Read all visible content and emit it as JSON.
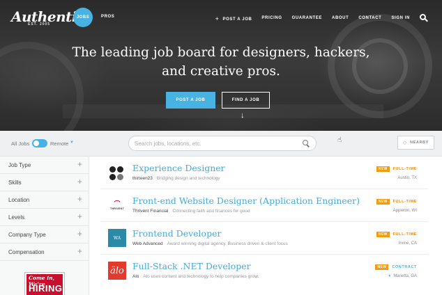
{
  "brand": {
    "logo_text": "Authentic",
    "logo_sub": "EST. 2005"
  },
  "nav": {
    "jobs_label": "JOBS",
    "pros_label": "PROS",
    "items": [
      {
        "label": "POST A JOB",
        "icon": "plus-icon"
      },
      {
        "label": "PRICING"
      },
      {
        "label": "GUARANTEE"
      },
      {
        "label": "ABOUT"
      },
      {
        "label": "CONTACT"
      },
      {
        "label": "SIGN IN"
      }
    ]
  },
  "hero": {
    "headline_line1": "The leading job board for designers, hackers,",
    "headline_line2": "and creative pros.",
    "post_button": "POST A JOB",
    "find_button": "FIND A JOB",
    "arrow": "↓"
  },
  "filterbar": {
    "all_jobs": "All Jobs",
    "remote": "Remote",
    "remote_enabled": true,
    "search_placeholder": "Search jobs, locations, etc.",
    "nearby": "NEARBY"
  },
  "sidebar": {
    "filters": [
      {
        "label": "Job Type"
      },
      {
        "label": "Skills"
      },
      {
        "label": "Location"
      },
      {
        "label": "Levels"
      },
      {
        "label": "Company Type"
      },
      {
        "label": "Compensation"
      }
    ],
    "ad_line1": "Come in, We're",
    "ad_line2": "HIRING"
  },
  "colors": {
    "accent": "#48b3e3",
    "new_badge": "#f39c12",
    "full_time": "#e8890c",
    "contract": "#48b3e3"
  },
  "jobs": [
    {
      "title": "Experience Designer",
      "company": "thirteen23",
      "tagline": "Bridging design and technology",
      "badge": "NEW",
      "type": "FULL-TIME",
      "location": "Austin, TX",
      "logo": "thirteen23-dots"
    },
    {
      "title": "Front-end Website Designer (Application Engineer)",
      "company": "Thrivent Financial",
      "tagline": "Connecting faith and finances for good",
      "badge": "NEW",
      "type": "FULL-TIME",
      "location": "Appleton, WI",
      "logo": "thrivent",
      "logo_mark": "⌒",
      "logo_text": "THRIVENT"
    },
    {
      "title": "Frontend Developer",
      "company": "Web Advanced",
      "tagline": "Award winning digital agency. Business driven & client focus",
      "badge": "NEW",
      "type": "FULL-TIME",
      "location": "Irvine, CA",
      "logo": "web-advanced",
      "logo_text": "WA"
    },
    {
      "title": "Full-Stack .NET Developer",
      "company": "Alo",
      "tagline": "Alo uses content and technology to help companies grow.",
      "badge": "NEW",
      "type": "CONTRACT",
      "location": "Marietta, GA",
      "remote_icon": true,
      "logo": "alo",
      "logo_text": "ālo"
    }
  ]
}
